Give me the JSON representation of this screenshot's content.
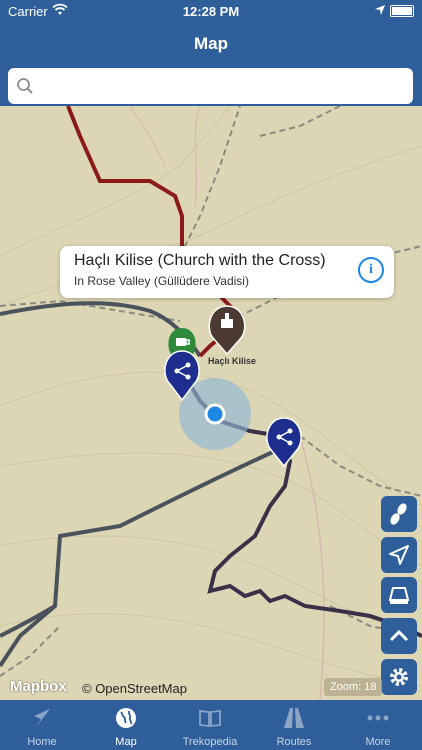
{
  "status_bar": {
    "carrier": "Carrier",
    "time": "12:28 PM"
  },
  "nav": {
    "title": "Map"
  },
  "search": {
    "placeholder": ""
  },
  "callout": {
    "title": "Haçlı Kilise (Church with the Cross)",
    "subtitle": "In Rose Valley (Güllüdere Vadisi)"
  },
  "map": {
    "pin_label": "Haçlı Kilise",
    "attribution_mapbox": "Mapbox",
    "attribution_osm": "© OpenStreetMap",
    "zoom_label": "Zoom: 18"
  },
  "side_buttons": [
    "footprints-icon",
    "navigate-arrow-icon",
    "layers-icon",
    "chevron-up-icon",
    "gear-icon"
  ],
  "tabs": [
    {
      "label": "Home",
      "icon": "navigation-arrow-icon",
      "active": false
    },
    {
      "label": "Map",
      "icon": "globe-icon",
      "active": true
    },
    {
      "label": "Trekopedia",
      "icon": "book-icon",
      "active": false
    },
    {
      "label": "Routes",
      "icon": "road-icon",
      "active": false
    },
    {
      "label": "More",
      "icon": "ellipsis-icon",
      "active": false
    }
  ],
  "colors": {
    "brand": "#2e5f9b",
    "map_bg": "#ddd6b4",
    "route_red": "#8b1a1a",
    "route_dark": "#3a3048",
    "pin_blue": "#1e2e8e",
    "info_blue": "#1e88e5"
  }
}
